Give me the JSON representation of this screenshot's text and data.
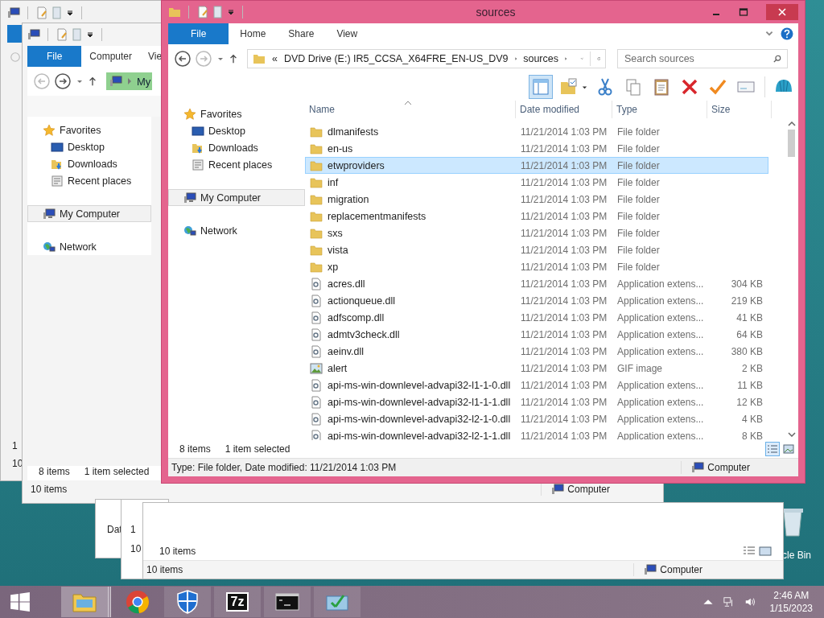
{
  "back_window_1": {
    "footer": [
      "1",
      "10"
    ]
  },
  "back_window_2": {
    "tabs": [
      {
        "label": "File",
        "selected": true
      },
      {
        "label": "Computer",
        "selected": false
      },
      {
        "label": "Vie",
        "selected": false
      }
    ],
    "address": "My",
    "nav": [
      {
        "label": "Favorites",
        "kind": "favorites",
        "selected": false
      },
      {
        "label": "Desktop",
        "kind": "desktop",
        "selected": false
      },
      {
        "label": "Downloads",
        "kind": "downloads",
        "selected": false
      },
      {
        "label": "Recent places",
        "kind": "recent",
        "selected": false
      },
      {
        "label": "My Computer",
        "kind": "computer",
        "selected": true
      },
      {
        "label": "Network",
        "kind": "network",
        "selected": false
      }
    ],
    "status": {
      "count": "8 items",
      "selection": "1 item selected"
    },
    "status_bar": {
      "count": "10 items",
      "location": "Computer"
    }
  },
  "cascade_windows": [
    {
      "texts": [
        "Dat"
      ]
    },
    {
      "texts": [
        "1",
        "10"
      ]
    }
  ],
  "back_window_3": {
    "count": "10 items",
    "status_bar": {
      "count": "10 items",
      "location": "Computer"
    }
  },
  "desktop": {
    "recycle_bin_label": "cle Bin"
  },
  "main_window": {
    "title": "sources",
    "tabs": [
      {
        "label": "File",
        "selected": true
      },
      {
        "label": "Home",
        "selected": false
      },
      {
        "label": "Share",
        "selected": false
      },
      {
        "label": "View",
        "selected": false
      }
    ],
    "address": {
      "overflow": "«",
      "segments": [
        "DVD Drive (E:) IR5_CCSA_X64FRE_EN-US_DV9",
        "sources"
      ]
    },
    "search": {
      "placeholder": "Search sources"
    },
    "nav": [
      {
        "label": "Favorites",
        "kind": "favorites",
        "selected": false
      },
      {
        "label": "Desktop",
        "kind": "desktop",
        "selected": false
      },
      {
        "label": "Downloads",
        "kind": "downloads",
        "selected": false
      },
      {
        "label": "Recent places",
        "kind": "recent",
        "selected": false
      },
      {
        "label": "My Computer",
        "kind": "computer",
        "selected": true
      },
      {
        "label": "Network",
        "kind": "network",
        "selected": false
      }
    ],
    "columns": [
      "Name",
      "Date modified",
      "Type",
      "Size"
    ],
    "rows": [
      {
        "kind": "folder",
        "name": "dlmanifests",
        "date": "11/21/2014 1:03 PM",
        "type": "File folder",
        "selected": false
      },
      {
        "kind": "folder",
        "name": "en-us",
        "date": "11/21/2014 1:03 PM",
        "type": "File folder",
        "selected": false
      },
      {
        "kind": "folder",
        "name": "etwproviders",
        "date": "11/21/2014 1:03 PM",
        "type": "File folder",
        "selected": true
      },
      {
        "kind": "folder",
        "name": "inf",
        "date": "11/21/2014 1:03 PM",
        "type": "File folder",
        "selected": false
      },
      {
        "kind": "folder",
        "name": "migration",
        "date": "11/21/2014 1:03 PM",
        "type": "File folder",
        "selected": false
      },
      {
        "kind": "folder",
        "name": "replacementmanifests",
        "date": "11/21/2014 1:03 PM",
        "type": "File folder",
        "selected": false
      },
      {
        "kind": "folder",
        "name": "sxs",
        "date": "11/21/2014 1:03 PM",
        "type": "File folder",
        "selected": false
      },
      {
        "kind": "folder",
        "name": "vista",
        "date": "11/21/2014 1:03 PM",
        "type": "File folder",
        "selected": false
      },
      {
        "kind": "folder",
        "name": "xp",
        "date": "11/21/2014 1:03 PM",
        "type": "File folder",
        "selected": false
      },
      {
        "kind": "dll",
        "name": "acres.dll",
        "date": "11/21/2014 1:03 PM",
        "type": "Application extens...",
        "size": "304 KB",
        "selected": false
      },
      {
        "kind": "dll",
        "name": "actionqueue.dll",
        "date": "11/21/2014 1:03 PM",
        "type": "Application extens...",
        "size": "219 KB",
        "selected": false
      },
      {
        "kind": "dll",
        "name": "adfscomp.dll",
        "date": "11/21/2014 1:03 PM",
        "type": "Application extens...",
        "size": "41 KB",
        "selected": false
      },
      {
        "kind": "dll",
        "name": "admtv3check.dll",
        "date": "11/21/2014 1:03 PM",
        "type": "Application extens...",
        "size": "64 KB",
        "selected": false
      },
      {
        "kind": "dll",
        "name": "aeinv.dll",
        "date": "11/21/2014 1:03 PM",
        "type": "Application extens...",
        "size": "380 KB",
        "selected": false
      },
      {
        "kind": "gif",
        "name": "alert",
        "date": "11/21/2014 1:03 PM",
        "type": "GIF image",
        "size": "2 KB",
        "selected": false
      },
      {
        "kind": "dll",
        "name": "api-ms-win-downlevel-advapi32-l1-1-0.dll",
        "date": "11/21/2014 1:03 PM",
        "type": "Application extens...",
        "size": "11 KB",
        "selected": false
      },
      {
        "kind": "dll",
        "name": "api-ms-win-downlevel-advapi32-l1-1-1.dll",
        "date": "11/21/2014 1:03 PM",
        "type": "Application extens...",
        "size": "12 KB",
        "selected": false
      },
      {
        "kind": "dll",
        "name": "api-ms-win-downlevel-advapi32-l2-1-0.dll",
        "date": "11/21/2014 1:03 PM",
        "type": "Application extens...",
        "size": "4 KB",
        "selected": false
      },
      {
        "kind": "dll",
        "name": "api-ms-win-downlevel-advapi32-l2-1-1.dll",
        "date": "11/21/2014 1:03 PM",
        "type": "Application extens...",
        "size": "8 KB",
        "selected": false
      }
    ],
    "status": {
      "count": "8 items",
      "selection": "1 item selected"
    },
    "view_modes": [
      {
        "kind": "details",
        "selected": true
      },
      {
        "kind": "tiles",
        "selected": false
      }
    ],
    "details_bar": {
      "text": "Type: File folder, Date modified: 11/21/2014 1:03 PM",
      "location": "Computer"
    }
  },
  "taskbar": {
    "items": [
      {
        "kind": "explorer",
        "selected": true
      },
      {
        "kind": "chrome",
        "selected": false
      },
      {
        "kind": "defender",
        "selected": false
      },
      {
        "kind": "sevenzip",
        "selected": false,
        "label": "7z"
      },
      {
        "kind": "cmd",
        "selected": false
      },
      {
        "kind": "installer",
        "selected": false
      }
    ],
    "time": "2:46 AM",
    "date": "1/15/2023"
  }
}
